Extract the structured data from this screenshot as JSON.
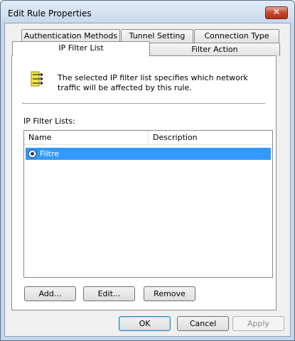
{
  "window": {
    "title": "Edit Rule Properties",
    "close_glyph": "✕"
  },
  "tabs": [
    {
      "label": "Authentication Methods"
    },
    {
      "label": "Tunnel Setting"
    },
    {
      "label": "Connection Type"
    },
    {
      "label": "IP Filter List"
    },
    {
      "label": "Filter Action"
    }
  ],
  "selected_tab": "IP Filter List",
  "panel": {
    "description": "The selected IP filter list specifies which network traffic will be affected by this rule.",
    "list_label": "IP Filter Lists:",
    "columns": [
      "Name",
      "Description"
    ],
    "rows": [
      {
        "name": "Filtre",
        "description": "",
        "selected": true
      }
    ],
    "buttons": {
      "add": "Add...",
      "edit": "Edit...",
      "remove": "Remove"
    }
  },
  "footer": {
    "ok": "OK",
    "cancel": "Cancel",
    "apply": "Apply"
  },
  "colors": {
    "selection": "#3399ff",
    "frame": "#c6d6ea",
    "close_button": "#c4452c"
  },
  "icons": {
    "filter": "ip-filter-list-icon",
    "radio": "radio-selected-icon",
    "close": "close-icon"
  }
}
